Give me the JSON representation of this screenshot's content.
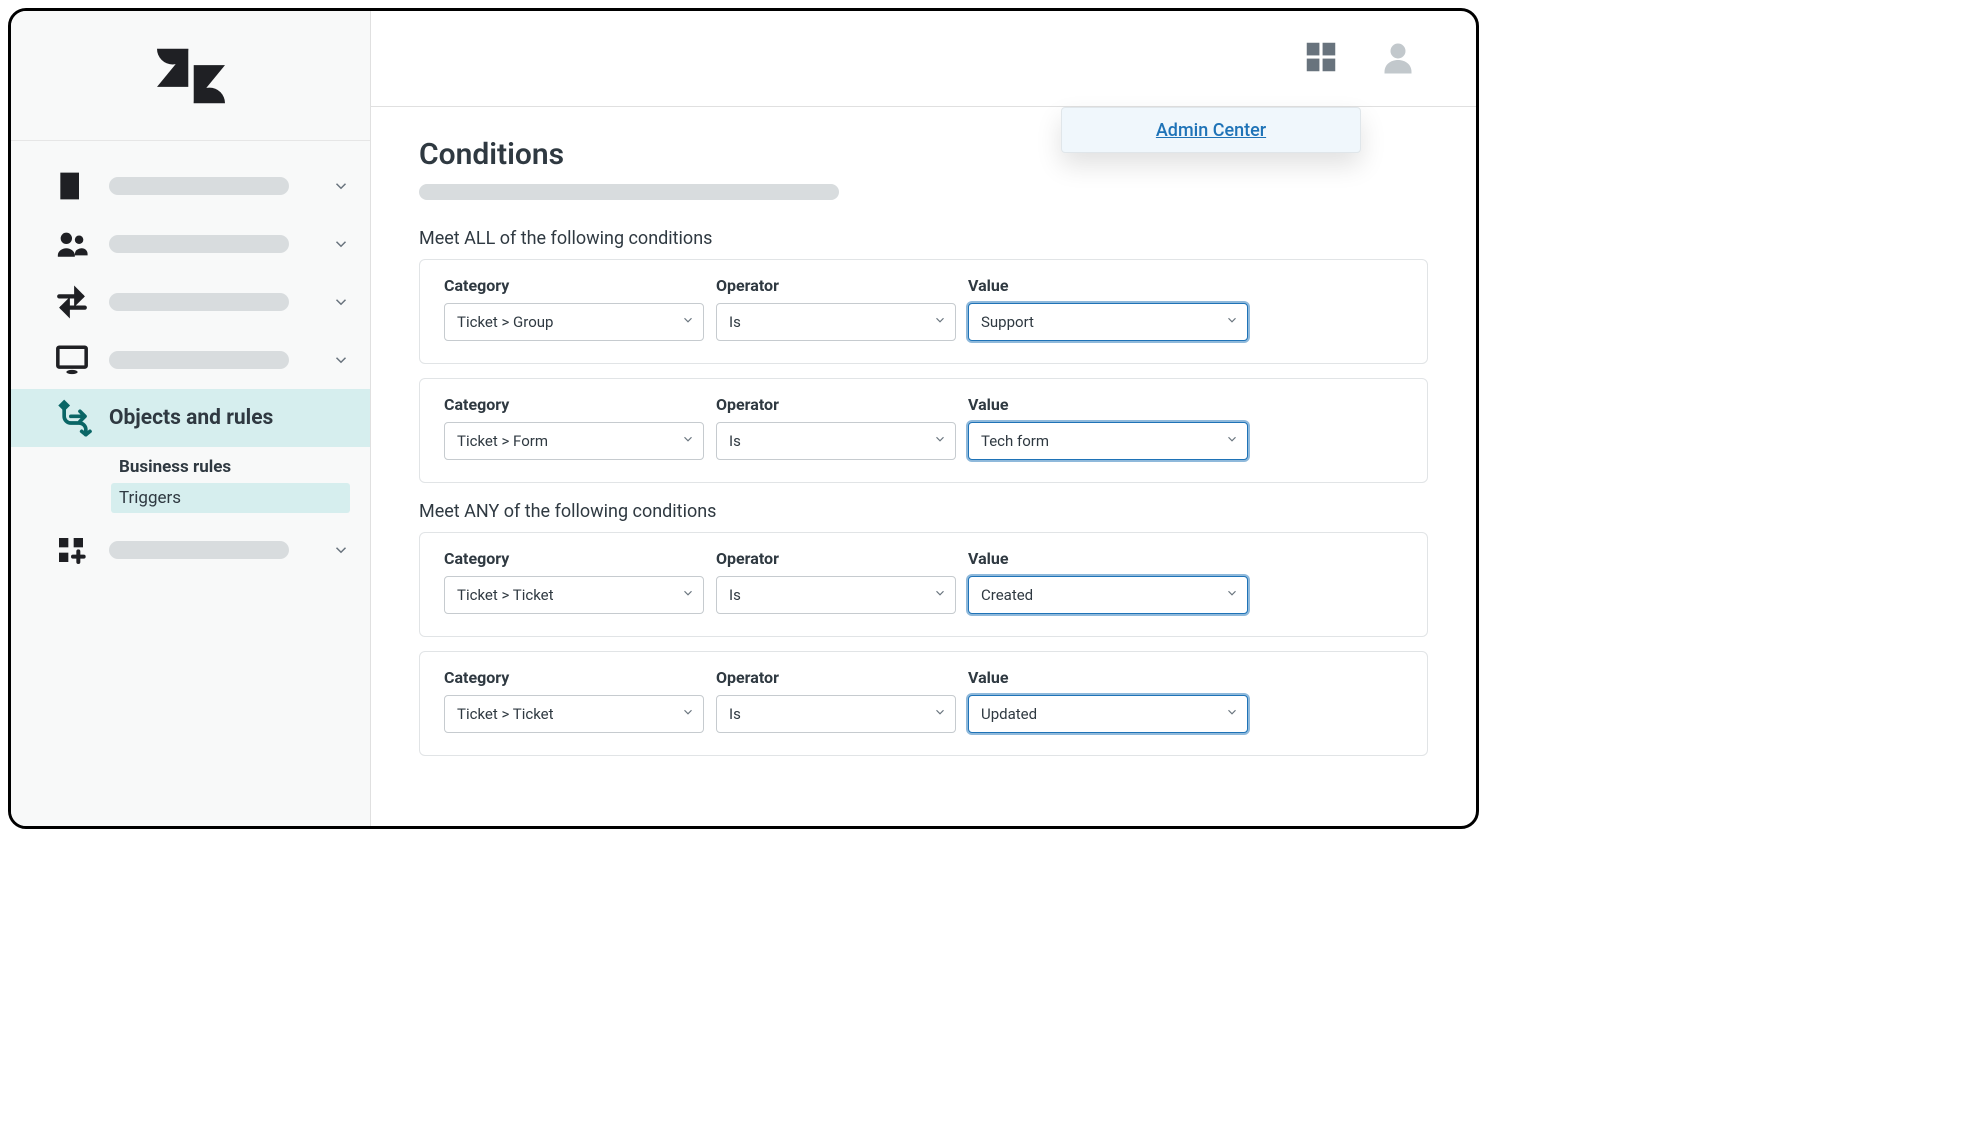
{
  "popover": {
    "admin_center": "Admin Center"
  },
  "sidebar": {
    "active_label": "Objects and rules",
    "sub_heading": "Business rules",
    "sub_item_triggers": "Triggers"
  },
  "main": {
    "title": "Conditions",
    "all_label": "Meet ALL of the following conditions",
    "any_label": "Meet ANY of the following conditions",
    "labels": {
      "category": "Category",
      "operator": "Operator",
      "value": "Value"
    },
    "all_conditions": [
      {
        "category": "Ticket > Group",
        "operator": "Is",
        "value": "Support"
      },
      {
        "category": "Ticket > Form",
        "operator": "Is",
        "value": "Tech form"
      }
    ],
    "any_conditions": [
      {
        "category": "Ticket > Ticket",
        "operator": "Is",
        "value": "Created"
      },
      {
        "category": "Ticket > Ticket",
        "operator": "Is",
        "value": "Updated"
      }
    ]
  }
}
